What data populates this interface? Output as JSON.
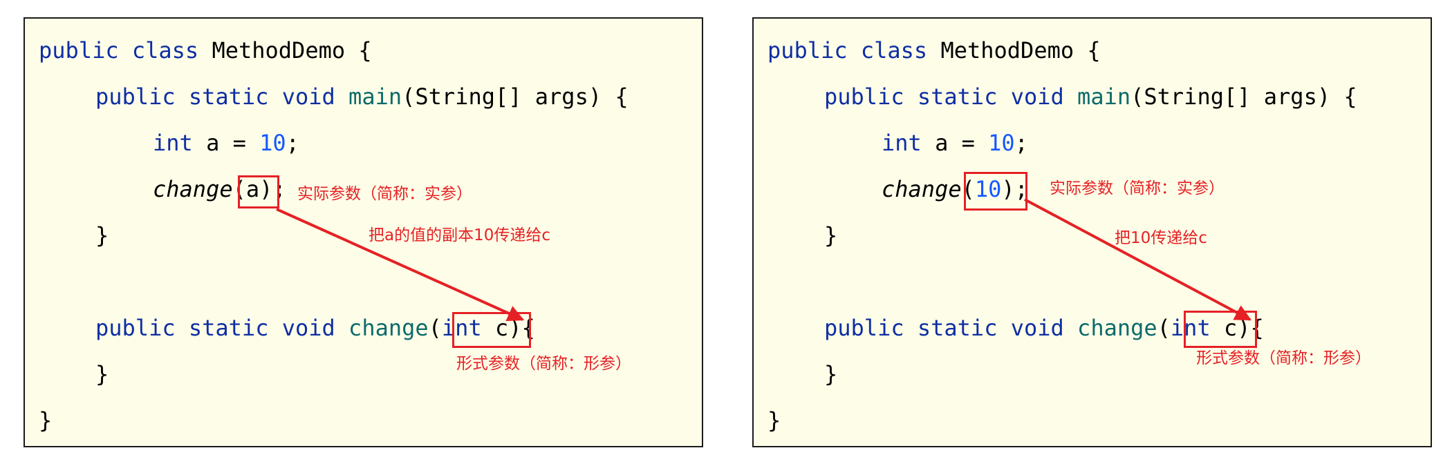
{
  "panels": [
    {
      "code": {
        "class_decl_kw": "public class",
        "class_name": "MethodDemo",
        "open_brace": "{",
        "main_kw": "public static void",
        "main_name": "main",
        "main_params": "(String[] args) {",
        "int_kw": "int",
        "assign": "a =",
        "ten": "10",
        "semicolon": ";",
        "call_name": "change",
        "call_arg": "(a)",
        "close_brace": "}",
        "change_kw": "public static void",
        "change_name": "change",
        "param_open": "(",
        "param_type": "int",
        "param_rest": "c)",
        "brace_after": "{"
      },
      "annotations": {
        "actual_param": "实际参数（简称：实参）",
        "arrow_label": "把a的值的副本10传递给c",
        "formal_param": "形式参数（简称：形参）"
      }
    },
    {
      "code": {
        "class_decl_kw": "public class",
        "class_name": "MethodDemo",
        "open_brace": "{",
        "main_kw": "public static void",
        "main_name": "main",
        "main_params": "(String[] args) {",
        "int_kw": "int",
        "assign": "a =",
        "ten": "10",
        "semicolon": ";",
        "call_name": "change",
        "call_paren_open": "(",
        "call_arg": "10",
        "call_paren_close": ")",
        "close_brace": "}",
        "change_kw": "public static void",
        "change_name": "change",
        "param_open": "(",
        "param_type": "int",
        "param_rest": "c)",
        "brace_after": "{"
      },
      "annotations": {
        "actual_param": "实际参数（简称：实参）",
        "arrow_label": "把10传递给c",
        "formal_param": "形式参数（简称：形参）"
      }
    }
  ],
  "colors": {
    "panel_background": "#fefee8",
    "keyword": "#0f2ea3",
    "method_name": "#0d6b6b",
    "number": "#1658ff",
    "annotation_red": "#e52125"
  }
}
